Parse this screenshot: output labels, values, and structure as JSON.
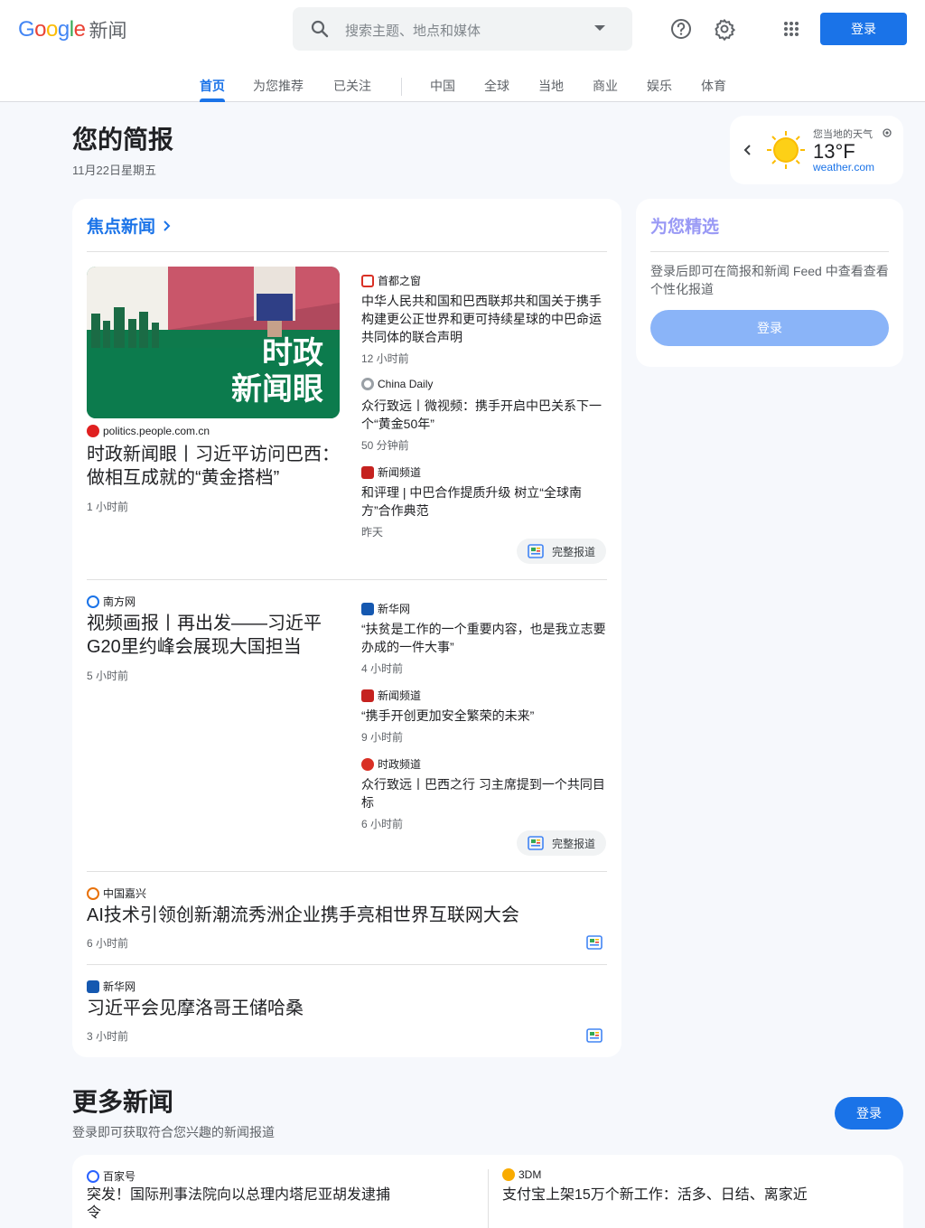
{
  "header": {
    "logo_google": "Google",
    "logo_news": "新闻",
    "search_placeholder": "搜索主题、地点和媒体",
    "login": "登录"
  },
  "nav": {
    "tabs": [
      "首页",
      "为您推荐",
      "已关注",
      "中国",
      "全球",
      "当地",
      "商业",
      "娱乐",
      "体育"
    ]
  },
  "briefing": {
    "title": "您的简报",
    "date": "11月22日星期五"
  },
  "weather": {
    "label": "您当地的天气",
    "temp": "13°F",
    "source": "weather.com"
  },
  "top_stories": {
    "heading": "焦点新闻",
    "full_coverage": "完整报道",
    "cluster1": {
      "image_text": "时政\n新闻眼",
      "main": {
        "source": "politics.people.com.cn",
        "title": "时政新闻眼丨习近平访问巴西：做相互成就的“黄金搭档”",
        "time": "1 小时前"
      },
      "related": [
        {
          "source": "首都之窗",
          "title": "中华人民共和国和巴西联邦共和国关于携手构建更公正世界和更可持续星球的中巴命运共同体的联合声明",
          "time": "12 小时前"
        },
        {
          "source": "China Daily",
          "title": "众行致远丨微视频：携手开启中巴关系下一个“黄金50年”",
          "time": "50 分钟前"
        },
        {
          "source": "新闻频道",
          "title": "和评理 | 中巴合作提质升级 树立“全球南方”合作典范",
          "time": "昨天"
        }
      ]
    },
    "cluster2": {
      "main": {
        "source": "南方网",
        "title": "视频画报丨再出发——习近平G20里约峰会展现大国担当",
        "time": "5 小时前"
      },
      "related": [
        {
          "source": "新华网",
          "title": "“扶贫是工作的一个重要内容，也是我立志要办成的一件大事”",
          "time": "4 小时前"
        },
        {
          "source": "新闻频道",
          "title": "“携手开创更加安全繁荣的未来”",
          "time": "9 小时前"
        },
        {
          "source": "时政频道",
          "title": "众行致远丨巴西之行 习主席提到一个共同目标",
          "time": "6 小时前"
        }
      ]
    },
    "single": [
      {
        "source": "中国嘉兴",
        "title": "AI技术引领创新潮流秀洲企业携手亮相世界互联网大会",
        "time": "6 小时前"
      },
      {
        "source": "新华网",
        "title": "习近平会见摩洛哥王储哈桑",
        "time": "3 小时前"
      }
    ]
  },
  "picks": {
    "title": "为您精选",
    "desc": "登录后即可在简报和新闻 Feed 中查看查看个性化报道",
    "button": "登录"
  },
  "more": {
    "title": "更多新闻",
    "subtitle": "登录即可获取符合您兴趣的新闻报道",
    "button": "登录",
    "items": [
      {
        "source": "百家号",
        "title": "突发！国际刑事法院向以总理内塔尼亚胡发逮捕令"
      },
      {
        "source": "3DM",
        "title": "支付宝上架15万个新工作：活多、日结、离家近"
      }
    ]
  }
}
